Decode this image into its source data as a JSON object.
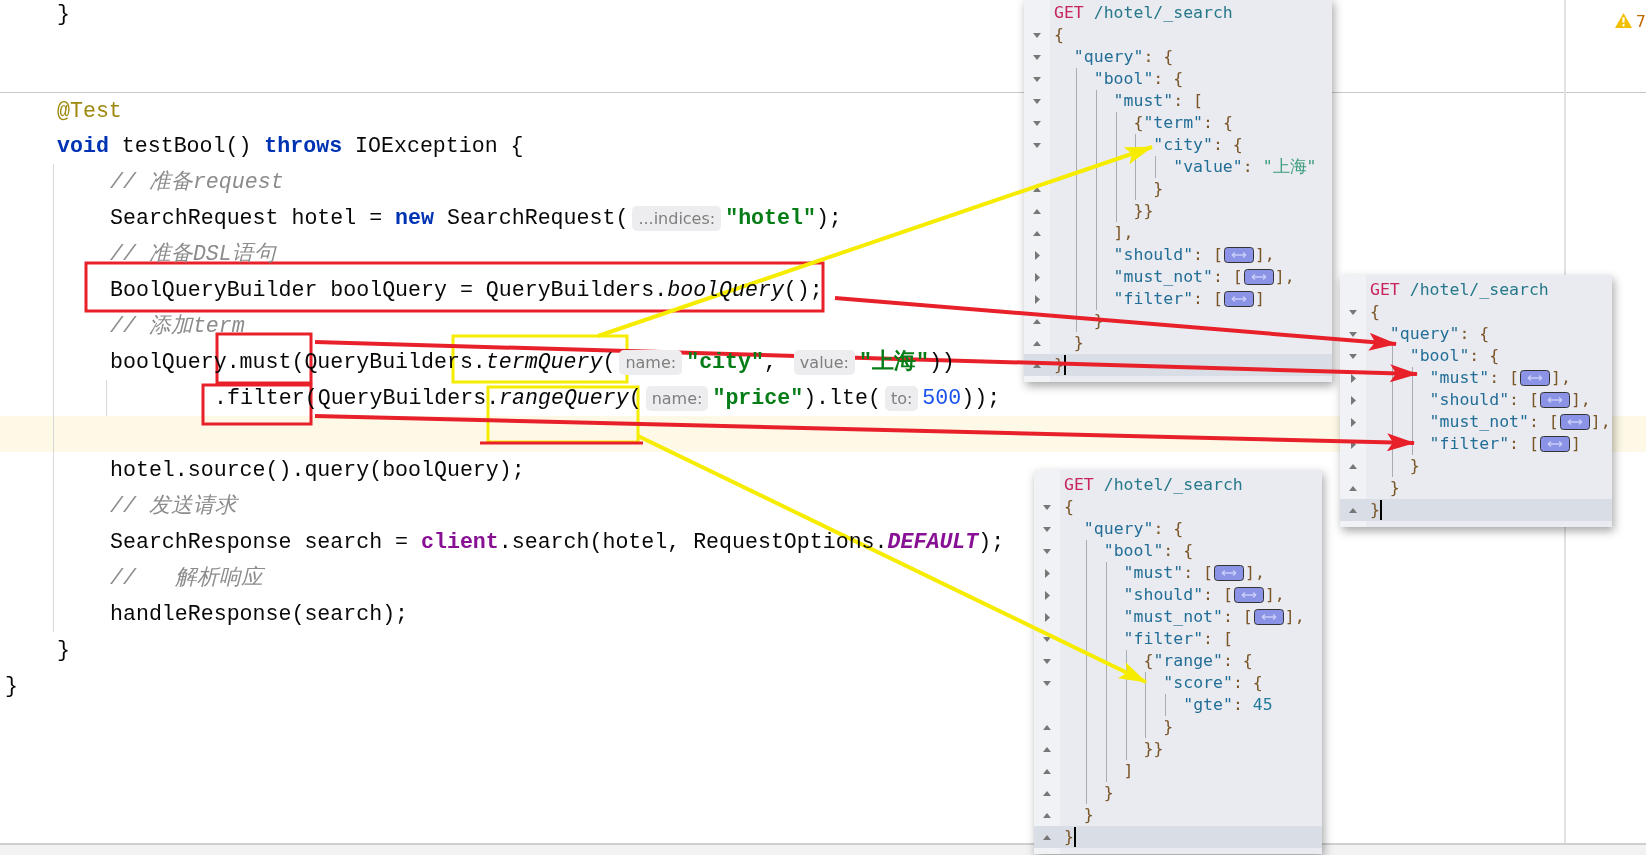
{
  "editor": {
    "lines": [
      {
        "children": [
          {
            "separator_above": false,
            "tokens": [
              {
                "kind": "plain",
                "text": "}"
              }
            ]
          },
          {
            "separator_above": true,
            "tokens": [
              {
                "kind": "annotation",
                "text": "@Test"
              }
            ]
          },
          {
            "separator_above": false,
            "tokens": [
              {
                "kind": "keyword",
                "text": "void"
              },
              {
                "kind": "plain",
                "text": " testBool() "
              },
              {
                "kind": "keyword",
                "text": "throws"
              },
              {
                "kind": "plain",
                "text": " IOException {"
              }
            ],
            "children": [
              {
                "current": false,
                "tokens": [
                  {
                    "kind": "comment",
                    "text": "// 准备request"
                  }
                ]
              },
              {
                "current": false,
                "tokens": [
                  {
                    "kind": "plain",
                    "text": "SearchRequest hotel = "
                  },
                  {
                    "kind": "keyword",
                    "text": "new"
                  },
                  {
                    "kind": "plain",
                    "text": " SearchRequest("
                  },
                  {
                    "kind": "hint",
                    "text": "...indices:"
                  },
                  {
                    "kind": "string",
                    "text": "\"hotel\""
                  },
                  {
                    "kind": "plain",
                    "text": ");"
                  }
                ]
              },
              {
                "current": false,
                "tokens": [
                  {
                    "kind": "comment",
                    "text": "// 准备DSL语句"
                  }
                ]
              },
              {
                "current": false,
                "tokens": [
                  {
                    "kind": "plain",
                    "text": "BoolQueryBuilder boolQuery = QueryBuilders."
                  },
                  {
                    "kind": "italic",
                    "text": "boolQuery"
                  },
                  {
                    "kind": "plain",
                    "text": "();"
                  }
                ]
              },
              {
                "current": false,
                "tokens": [
                  {
                    "kind": "comment",
                    "text": "// 添加term"
                  }
                ]
              },
              {
                "current": false,
                "tokens": [
                  {
                    "kind": "plain",
                    "text": "boolQuery.must(QueryBuilders."
                  },
                  {
                    "kind": "italic",
                    "text": "termQuery"
                  },
                  {
                    "kind": "plain",
                    "text": "("
                  },
                  {
                    "kind": "hint",
                    "text": "name:"
                  },
                  {
                    "kind": "string",
                    "text": "\"city\""
                  },
                  {
                    "kind": "plain",
                    "text": ", "
                  },
                  {
                    "kind": "hint",
                    "text": "value:"
                  },
                  {
                    "kind": "string",
                    "text": "\"上海\""
                  },
                  {
                    "kind": "plain",
                    "text": "))"
                  }
                ],
                "children": [
                  {
                    "current": false,
                    "tokens": [
                      {
                        "kind": "plain",
                        "text": ".filter(QueryBuilders."
                      },
                      {
                        "kind": "italic",
                        "text": "rangeQuery"
                      },
                      {
                        "kind": "plain",
                        "text": "("
                      },
                      {
                        "kind": "hint",
                        "text": "name:"
                      },
                      {
                        "kind": "string",
                        "text": "\"price\""
                      },
                      {
                        "kind": "plain",
                        "text": ").lte("
                      },
                      {
                        "kind": "hint",
                        "text": "to:"
                      },
                      {
                        "kind": "number",
                        "text": "500"
                      },
                      {
                        "kind": "plain",
                        "text": "));"
                      }
                    ]
                  }
                ]
              },
              {
                "current": true
              },
              {
                "current": false,
                "tokens": [
                  {
                    "kind": "plain",
                    "text": "hotel.source().query(boolQuery);"
                  }
                ]
              },
              {
                "current": false,
                "tokens": [
                  {
                    "kind": "comment",
                    "text": "// 发送请求"
                  }
                ]
              },
              {
                "current": false,
                "tokens": [
                  {
                    "kind": "plain",
                    "text": "SearchResponse search = "
                  },
                  {
                    "kind": "field",
                    "text": "client"
                  },
                  {
                    "kind": "plain",
                    "text": ".search(hotel, RequestOptions."
                  },
                  {
                    "kind": "constant",
                    "text": "DEFAULT"
                  },
                  {
                    "kind": "plain",
                    "text": ");"
                  }
                ]
              },
              {
                "current": false,
                "tokens": [
                  {
                    "kind": "comment",
                    "text": "//   解析响应"
                  }
                ]
              },
              {
                "current": false,
                "tokens": [
                  {
                    "kind": "plain",
                    "text": "handleResponse(search);"
                  }
                ]
              }
            ]
          },
          {
            "separator_above": false,
            "tokens": [
              {
                "kind": "plain",
                "text": "}"
              }
            ]
          }
        ]
      },
      {
        "tokens": [
          {
            "kind": "plain",
            "text": "}"
          }
        ]
      }
    ]
  },
  "inspections": {
    "warnings": "7"
  },
  "consoles": [
    {
      "request": {
        "method": "GET",
        "path": "/hotel/_search"
      },
      "lines": [
        {
          "expanded": true,
          "current": false,
          "tokens": [
            {
              "kind": "punct",
              "text": "{"
            }
          ],
          "children": [
            {
              "expanded": true,
              "tokens": [
                {
                  "kind": "key",
                  "text": "\"query\""
                },
                {
                  "kind": "punct",
                  "text": ": {"
                }
              ],
              "children": [
                {
                  "expanded": true,
                  "tokens": [
                    {
                      "kind": "key",
                      "text": "\"bool\""
                    },
                    {
                      "kind": "punct",
                      "text": ": {"
                    }
                  ],
                  "children": [
                    {
                      "expanded": true,
                      "tokens": [
                        {
                          "kind": "key",
                          "text": "\"must\""
                        },
                        {
                          "kind": "punct",
                          "text": ": ["
                        }
                      ],
                      "children": [
                        {
                          "expanded": true,
                          "tokens": [
                            {
                              "kind": "punct",
                              "text": "{"
                            },
                            {
                              "kind": "key",
                              "text": "\"term\""
                            },
                            {
                              "kind": "punct",
                              "text": ": {"
                            }
                          ],
                          "children": [
                            {
                              "expanded": true,
                              "tokens": [
                                {
                                  "kind": "key",
                                  "text": "\"city\""
                                },
                                {
                                  "kind": "punct",
                                  "text": ": {"
                                }
                              ],
                              "children": [
                                {
                                  "tokens": [
                                    {
                                      "kind": "key",
                                      "text": "\"value\""
                                    },
                                    {
                                      "kind": "punct",
                                      "text": ": "
                                    },
                                    {
                                      "kind": "value",
                                      "text": "\"上海\""
                                    }
                                  ]
                                }
                              ]
                            },
                            {
                              "tokens": [
                                {
                                  "kind": "punct",
                                  "text": "}"
                                }
                              ]
                            }
                          ]
                        },
                        {
                          "tokens": [
                            {
                              "kind": "punct",
                              "text": "}}"
                            }
                          ]
                        }
                      ]
                    },
                    {
                      "tokens": [
                        {
                          "kind": "punct",
                          "text": "],"
                        }
                      ]
                    },
                    {
                      "expanded": false,
                      "tokens": [
                        {
                          "kind": "key",
                          "text": "\"should\""
                        },
                        {
                          "kind": "punct",
                          "text": ": ["
                        },
                        {
                          "kind": "collapsed"
                        },
                        {
                          "kind": "punct",
                          "text": "],"
                        }
                      ]
                    },
                    {
                      "expanded": false,
                      "tokens": [
                        {
                          "kind": "key",
                          "text": "\"must_not\""
                        },
                        {
                          "kind": "punct",
                          "text": ": ["
                        },
                        {
                          "kind": "collapsed"
                        },
                        {
                          "kind": "punct",
                          "text": "],"
                        }
                      ]
                    },
                    {
                      "expanded": false,
                      "tokens": [
                        {
                          "kind": "key",
                          "text": "\"filter\""
                        },
                        {
                          "kind": "punct",
                          "text": ": ["
                        },
                        {
                          "kind": "collapsed"
                        },
                        {
                          "kind": "punct",
                          "text": "]"
                        }
                      ]
                    }
                  ]
                },
                {
                  "tokens": [
                    {
                      "kind": "punct",
                      "text": "}"
                    }
                  ]
                }
              ]
            },
            {
              "tokens": [
                {
                  "kind": "punct",
                  "text": "}"
                }
              ]
            }
          ]
        },
        {
          "current": true,
          "tokens": [
            {
              "kind": "punct",
              "text": "}"
            }
          ]
        }
      ]
    },
    {
      "request": {
        "method": "GET",
        "path": "/hotel/_search"
      },
      "lines": [
        {
          "expanded": true,
          "current": false,
          "tokens": [
            {
              "kind": "punct",
              "text": "{"
            }
          ],
          "children": [
            {
              "expanded": true,
              "tokens": [
                {
                  "kind": "key",
                  "text": "\"query\""
                },
                {
                  "kind": "punct",
                  "text": ": {"
                }
              ],
              "children": [
                {
                  "expanded": true,
                  "tokens": [
                    {
                      "kind": "key",
                      "text": "\"bool\""
                    },
                    {
                      "kind": "punct",
                      "text": ": {"
                    }
                  ],
                  "children": [
                    {
                      "expanded": false,
                      "tokens": [
                        {
                          "kind": "key",
                          "text": "\"must\""
                        },
                        {
                          "kind": "punct",
                          "text": ": ["
                        },
                        {
                          "kind": "collapsed"
                        },
                        {
                          "kind": "punct",
                          "text": "],"
                        }
                      ]
                    },
                    {
                      "expanded": false,
                      "tokens": [
                        {
                          "kind": "key",
                          "text": "\"should\""
                        },
                        {
                          "kind": "punct",
                          "text": ": ["
                        },
                        {
                          "kind": "collapsed"
                        },
                        {
                          "kind": "punct",
                          "text": "],"
                        }
                      ]
                    },
                    {
                      "expanded": false,
                      "tokens": [
                        {
                          "kind": "key",
                          "text": "\"must_not\""
                        },
                        {
                          "kind": "punct",
                          "text": ": ["
                        },
                        {
                          "kind": "collapsed"
                        },
                        {
                          "kind": "punct",
                          "text": "],"
                        }
                      ]
                    },
                    {
                      "expanded": false,
                      "tokens": [
                        {
                          "kind": "key",
                          "text": "\"filter\""
                        },
                        {
                          "kind": "punct",
                          "text": ": ["
                        },
                        {
                          "kind": "collapsed"
                        },
                        {
                          "kind": "punct",
                          "text": "]"
                        }
                      ]
                    }
                  ]
                },
                {
                  "tokens": [
                    {
                      "kind": "punct",
                      "text": "}"
                    }
                  ]
                }
              ]
            },
            {
              "tokens": [
                {
                  "kind": "punct",
                  "text": "}"
                }
              ]
            }
          ]
        },
        {
          "current": true,
          "tokens": [
            {
              "kind": "punct",
              "text": "}"
            }
          ]
        }
      ]
    },
    {
      "request": {
        "method": "GET",
        "path": "/hotel/_search"
      },
      "lines": [
        {
          "expanded": true,
          "current": false,
          "tokens": [
            {
              "kind": "punct",
              "text": "{"
            }
          ],
          "children": [
            {
              "expanded": true,
              "tokens": [
                {
                  "kind": "key",
                  "text": "\"query\""
                },
                {
                  "kind": "punct",
                  "text": ": {"
                }
              ],
              "children": [
                {
                  "expanded": true,
                  "tokens": [
                    {
                      "kind": "key",
                      "text": "\"bool\""
                    },
                    {
                      "kind": "punct",
                      "text": ": {"
                    }
                  ],
                  "children": [
                    {
                      "expanded": false,
                      "tokens": [
                        {
                          "kind": "key",
                          "text": "\"must\""
                        },
                        {
                          "kind": "punct",
                          "text": ": ["
                        },
                        {
                          "kind": "collapsed"
                        },
                        {
                          "kind": "punct",
                          "text": "],"
                        }
                      ]
                    },
                    {
                      "expanded": false,
                      "tokens": [
                        {
                          "kind": "key",
                          "text": "\"should\""
                        },
                        {
                          "kind": "punct",
                          "text": ": ["
                        },
                        {
                          "kind": "collapsed"
                        },
                        {
                          "kind": "punct",
                          "text": "],"
                        }
                      ]
                    },
                    {
                      "expanded": false,
                      "tokens": [
                        {
                          "kind": "key",
                          "text": "\"must_not\""
                        },
                        {
                          "kind": "punct",
                          "text": ": ["
                        },
                        {
                          "kind": "collapsed"
                        },
                        {
                          "kind": "punct",
                          "text": "],"
                        }
                      ]
                    },
                    {
                      "expanded": true,
                      "tokens": [
                        {
                          "kind": "key",
                          "text": "\"filter\""
                        },
                        {
                          "kind": "punct",
                          "text": ": ["
                        }
                      ],
                      "children": [
                        {
                          "expanded": true,
                          "tokens": [
                            {
                              "kind": "punct",
                              "text": "{"
                            },
                            {
                              "kind": "key",
                              "text": "\"range\""
                            },
                            {
                              "kind": "punct",
                              "text": ": {"
                            }
                          ],
                          "children": [
                            {
                              "expanded": true,
                              "tokens": [
                                {
                                  "kind": "key",
                                  "text": "\"score\""
                                },
                                {
                                  "kind": "punct",
                                  "text": ": {"
                                }
                              ],
                              "children": [
                                {
                                  "tokens": [
                                    {
                                      "kind": "key",
                                      "text": "\"gte\""
                                    },
                                    {
                                      "kind": "punct",
                                      "text": ": "
                                    },
                                    {
                                      "kind": "number",
                                      "text": "45"
                                    }
                                  ]
                                }
                              ]
                            },
                            {
                              "tokens": [
                                {
                                  "kind": "punct",
                                  "text": "}"
                                }
                              ]
                            }
                          ]
                        },
                        {
                          "tokens": [
                            {
                              "kind": "punct",
                              "text": "}}"
                            }
                          ]
                        }
                      ]
                    },
                    {
                      "tokens": [
                        {
                          "kind": "punct",
                          "text": "]"
                        }
                      ]
                    }
                  ]
                },
                {
                  "tokens": [
                    {
                      "kind": "punct",
                      "text": "}"
                    }
                  ]
                }
              ]
            },
            {
              "tokens": [
                {
                  "kind": "punct",
                  "text": "}"
                }
              ]
            }
          ]
        },
        {
          "current": true,
          "tokens": [
            {
              "kind": "punct",
              "text": "}"
            }
          ]
        }
      ]
    }
  ]
}
